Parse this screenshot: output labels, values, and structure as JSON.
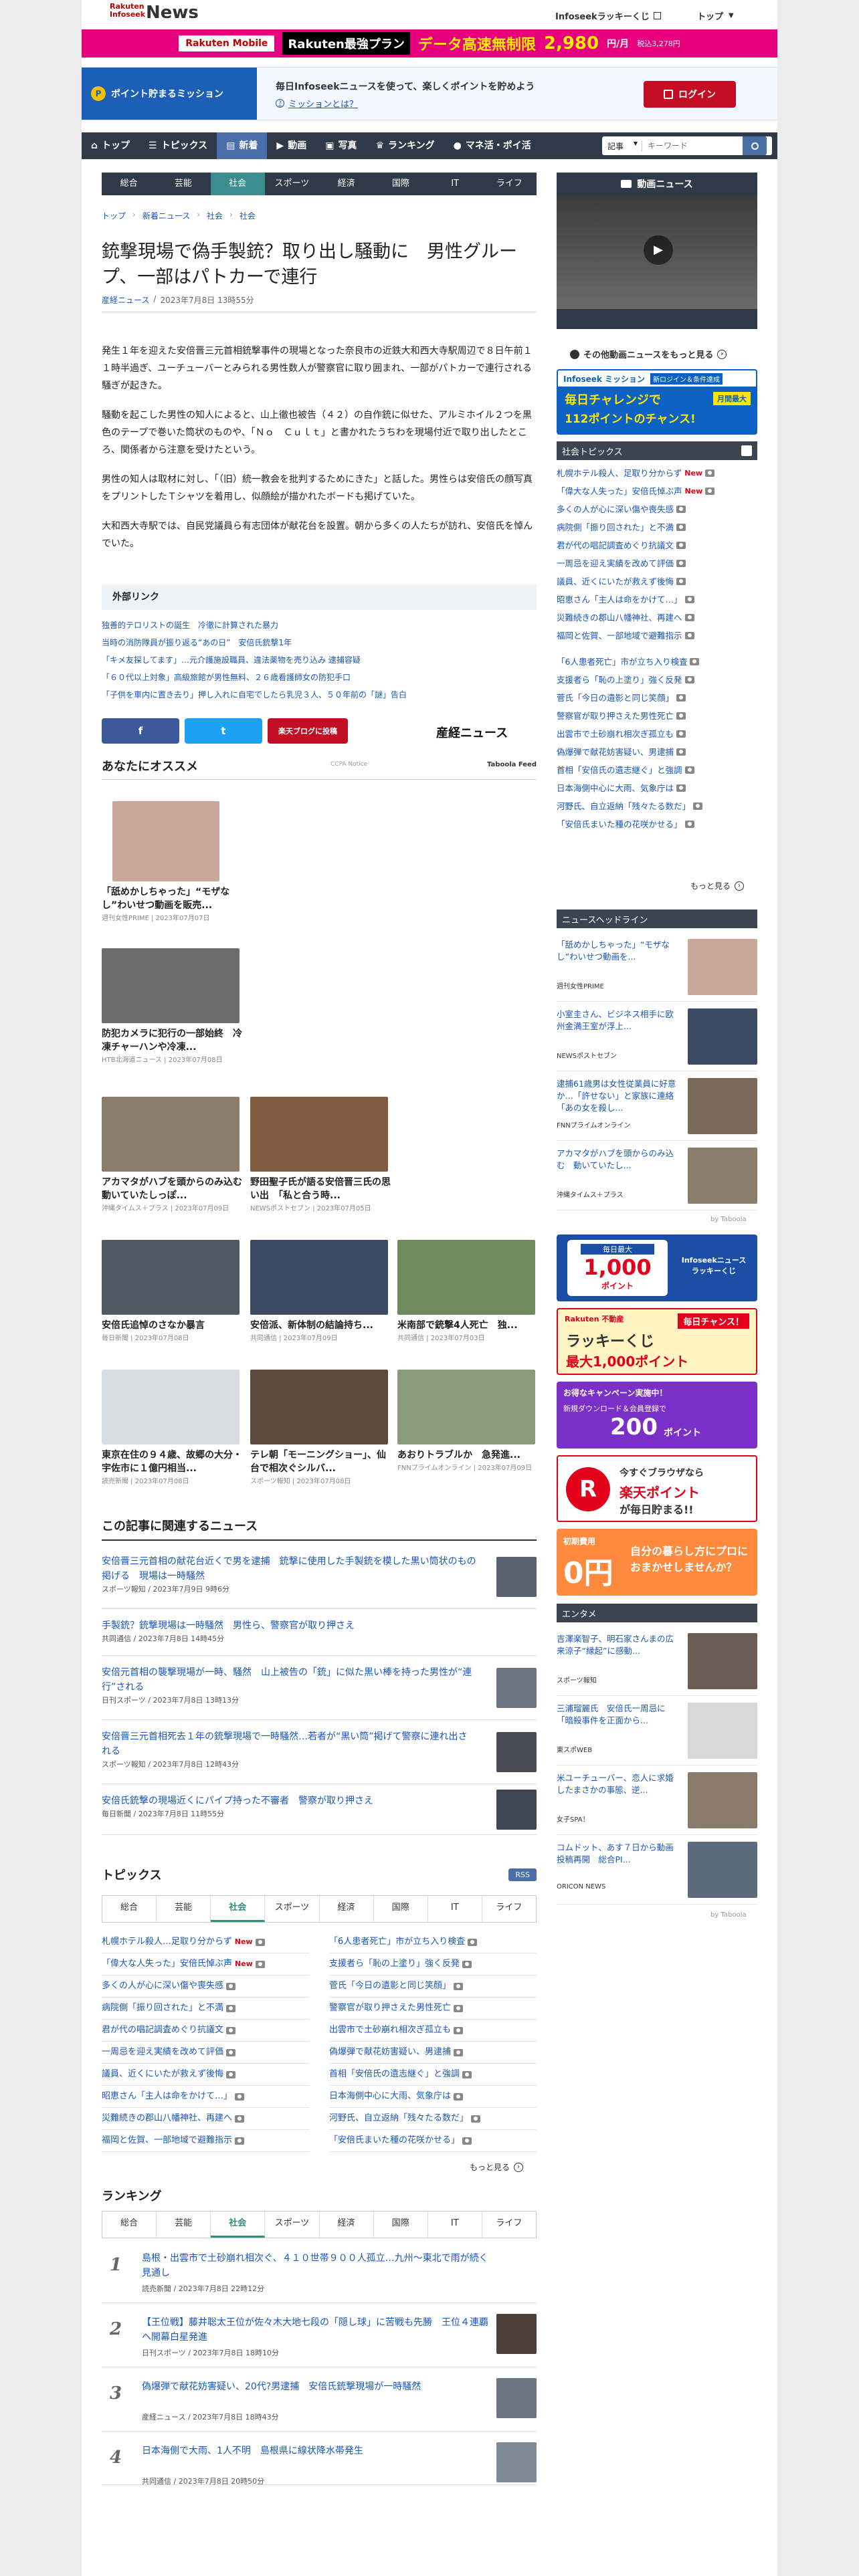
{
  "header": {
    "logo_small": "Rakuten\nInfoseek",
    "logo_big": "News",
    "util_1": "Infoseekラッキーくじ",
    "util_2": "トップ",
    "banner_text_1": "Rakuten Mobile",
    "banner_text_2": "Rakuten最強プラン",
    "banner_text_3": "データ高速無制限",
    "banner_price": "2,980",
    "banner_unit": "円/月",
    "banner_note": "税込3,278円"
  },
  "mission_bar": {
    "pill": "ポイント貯まるミッション",
    "text": "毎日Infoseekニュースを使って、楽しくポイントを貯めよう",
    "link": "ミッションとは？",
    "login": "ログイン"
  },
  "nav": {
    "items": [
      {
        "label": "トップ"
      },
      {
        "label": "トピックス"
      },
      {
        "label": "新着"
      },
      {
        "label": "動画"
      },
      {
        "label": "写真"
      },
      {
        "label": "ランキング"
      },
      {
        "label": "マネ活・ポイ活"
      }
    ],
    "search_select": "記事",
    "search_placeholder": "キーワード"
  },
  "subnav": [
    "総合",
    "芸能",
    "社会",
    "スポーツ",
    "経済",
    "国際",
    "IT",
    "ライフ"
  ],
  "breadcrumb": [
    "トップ",
    "新着ニュース",
    "社会",
    "社会"
  ],
  "article": {
    "title": "銃撃現場で偽手製銃？取り出し騒動に　男性グループ、一部はパトカーで連行",
    "source": "産経ニュース",
    "date": "2023年7月8日 13時55分",
    "paragraphs": [
      "発生１年を迎えた安倍晋三元首相銃撃事件の現場となった奈良市の近鉄大和西大寺駅周辺で８日午前１１時半過ぎ、ユーチューバーとみられる男性数人が警察官に取り囲まれ、一部がパトカーで連行される騒ぎが起きた。",
      "騒動を起こした男性の知人によると、山上徹也被告（４２）の自作銃に似せた、アルミホイル２つを黒色のテープで巻いた筒状のものや、「Ｎｏ　Ｃｕｌｔ」と書かれたうちわを現場付近で取り出したところ、関係者から注意を受けたという。",
      "男性の知人は取材に対し、「（旧）統一教会を批判するためにきた」と話した。男性らは安倍氏の顔写真をプリントしたＴシャツを着用し、似顔絵が描かれたボードも掲げていた。",
      "大和西大寺駅では、自民党議員ら有志団体が献花台を設置。朝から多くの人たちが訪れ、安倍氏を悼んでいた。"
    ]
  },
  "external_links": {
    "heading": "外部リンク",
    "items": [
      "独善的テロリストの誕生　冷徹に計算された暴力",
      "当時の消防隊員が振り返る“あの日”　安倍氏銃撃1年",
      "「キメ友探してます」…元介護施設職員、違法薬物を売り込み 逮捕容疑",
      "「６０代以上対象」高級旅館が男性無料、２６歳看護師女の防犯手口",
      "「子供を車内に置き去り」押し入れに自宅でしたら乳児３人、５０年前の「謎」告白"
    ]
  },
  "share": {
    "facebook": "f",
    "twitter": "t",
    "blog": "楽天ブログに投稿",
    "brand": "産経ニュース"
  },
  "recommend": {
    "heading": "あなたにオススメ",
    "powered": "CCPA Notice",
    "taboola": "Taboola Feed",
    "cards": [
      {
        "title": "「舐めかしちゃった」“モザなし”わいせつ動画を販売...",
        "meta": "週刊女性PRIME | 2023年07月07日",
        "color": "#c9a89a"
      },
      {
        "title": "防犯カメラに犯行の一部始終　冷凍チャーハンや冷凍...",
        "meta": "HTB北海道ニュース | 2023年07月08日",
        "color": "#6c6c6c"
      },
      {
        "title": "アカマタがハブを頭からのみ込む　動いていたしっぽ...",
        "meta": "沖縄タイムス＋プラス | 2023年07月09日",
        "color": "#8a7d6a"
      },
      {
        "title": "野田聖子氏が語る安倍晋三氏の思い出　「私と合う時...",
        "meta": "NEWSポストセブン | 2023年07月05日",
        "color": "#7f5b3f"
      },
      {
        "title": "安倍氏追悼のさなか暴言",
        "meta": "毎日新聞 | 2023年07月08日",
        "color": "#4f5a64"
      },
      {
        "title": "安倍派、新体制の結論持ち...",
        "meta": "共同通信 | 2023年07月09日",
        "color": "#3c4a66"
      },
      {
        "title": "米南部で銃撃4人死亡　独...",
        "meta": "共同通信 | 2023年07月03日",
        "color": "#6f8a5c"
      },
      {
        "title": "東京在住の９４歳、故郷の大分・宇佐市に１億円相当...",
        "meta": "読売新聞 | 2023年07月08日",
        "color": "#d9dde3"
      },
      {
        "title": "テレ朝「モーニングショー」、仙台で相次ぐシルバ...",
        "meta": "スポーツ報知 | 2023年07月08日",
        "color": "#5d4a3c"
      },
      {
        "title": "あおりトラブルか　急発進...",
        "meta": "FNNプライムオンライン | 2023年07月09日",
        "color": "#8a9a7a"
      }
    ]
  },
  "related": {
    "heading": "この記事に関連するニュース",
    "items": [
      {
        "title": "安倍晋三元首相の献花台近くで男を逮捕　銃撃に使用した手製銃を模した黒い筒状のもの掲げる　現場は一時騒然",
        "meta": "スポーツ報知 / 2023年7月9日 9時6分"
      },
      {
        "title": "手製銃？銃撃現場は一時騒然　男性ら、警察官が取り押さえ",
        "meta": "共同通信 / 2023年7月8日 14時45分"
      },
      {
        "title": "安倍元首相の襲撃現場が一時、騒然　山上被告の「銃」に似た黒い棒を持った男性が“連行”される",
        "meta": "日刊スポーツ / 2023年7月8日 13時13分"
      },
      {
        "title": "安倍晋三元首相死去１年の銃撃現場で一時騒然…若者が“黒い筒”掲げて警察に連れ出される",
        "meta": "スポーツ報知 / 2023年7月8日 12時43分"
      },
      {
        "title": "安倍氏銃撃の現場近くにパイプ持った不審者　警察が取り押さえ",
        "meta": "毎日新聞 / 2023年7月8日 11時55分"
      }
    ]
  },
  "topics": {
    "heading": "トピックス",
    "rss": "RSS",
    "tabs": [
      "総合",
      "芸能",
      "社会",
      "スポーツ",
      "経済",
      "国際",
      "IT",
      "ライフ"
    ],
    "left": [
      {
        "t": "札幌ホテル殺人…足取り分からず",
        "new": "New"
      },
      {
        "t": "「偉大な人失った」安倍氏悼ぶ声",
        "new": "New"
      },
      {
        "t": "多くの人が心に深い傷や喪失感",
        "new": ""
      },
      {
        "t": "病院側「振り回された」と不満",
        "new": ""
      },
      {
        "t": "君が代の唱記調査めぐり抗議文",
        "new": ""
      },
      {
        "t": "一周忌を迎え実績を改めて評価",
        "new": ""
      },
      {
        "t": "議員、近くにいたが救えず後悔",
        "new": ""
      },
      {
        "t": "昭恵さん「主人は命をかけて…」",
        "new": ""
      },
      {
        "t": "災難続きの郡山八幡神社、再建へ",
        "new": ""
      },
      {
        "t": "福岡と佐賀、一部地域で避難指示",
        "new": ""
      }
    ],
    "right": [
      "「6人患者死亡」市が立ち入り検査",
      "支援者ら「恥の上塗り」強く反発",
      "菅氏「今日の遺影と同じ笑顔」",
      "警察官が取り押さえた男性死亡",
      "出雲市で土砂崩れ相次ぎ孤立も",
      "偽爆弾で献花妨害疑い、男逮捕",
      "首相「安倍氏の遺志継ぐ」と強調",
      "日本海側中心に大雨、気象庁は",
      "河野氏、自立返納「残々たる数だ」",
      "「安倍氏まいた種の花咲かせる」"
    ],
    "more": "もっと見る"
  },
  "ranking": {
    "heading": "ランキング",
    "tabs": [
      "総合",
      "芸能",
      "社会",
      "スポーツ",
      "経済",
      "国際",
      "IT",
      "ライフ"
    ],
    "items": [
      {
        "num": "1",
        "title": "島根・出雲市で土砂崩れ相次ぐ、４１０世帯９００人孤立…九州～東北で雨が続く見通し",
        "meta": "読売新聞 / 2023年7月8日 22時12分",
        "thumb": ""
      },
      {
        "num": "2",
        "title": "【王位戦】藤井聡太王位が佐々木大地七段の「隠し球」に苦戦も先勝　王位４連覇へ開幕白星発進",
        "meta": "日刊スポーツ / 2023年7月8日 18時10分",
        "thumb": "#4a4038"
      },
      {
        "num": "3",
        "title": "偽爆弾で献花妨害疑い、20代?男逮捕　安倍氏銃撃現場が一時騒然",
        "meta": "産経ニュース / 2023年7月8日 18時43分",
        "thumb": "#6b7480"
      },
      {
        "num": "4",
        "title": "日本海側で大雨、1人不明　島根県に線状降水帯発生",
        "meta": "共同通信 / 2023年7月8日 20時50分",
        "thumb": "#7d8a96"
      }
    ]
  },
  "sidebar": {
    "video_heading": "動画ニュース",
    "video_more": "その他動画ニュースをもっと見る",
    "mission_banner": {
      "brand": "Infoseek ミッション",
      "tag": "新ロジイン＆条件達成",
      "line1": "毎日チャレンジで",
      "line2": "月間最大",
      "line3": "112ポイントのチャンス!"
    },
    "topics_heading": "社会トピックス",
    "topics": [
      {
        "t": "札幌ホテル殺人、足取り分からず",
        "new": "New"
      },
      {
        "t": "「偉大な人失った」安倍氏悼ぶ声",
        "new": "New"
      },
      {
        "t": "多くの人が心に深い傷や喪失感",
        "new": ""
      },
      {
        "t": "病院側「振り回された」と不満",
        "new": ""
      },
      {
        "t": "君が代の唱記調査めぐり抗議文",
        "new": ""
      },
      {
        "t": "一周忌を迎え実績を改めて評価",
        "new": ""
      },
      {
        "t": "議員、近くにいたが救えず後悔",
        "new": ""
      },
      {
        "t": "昭恵さん「主人は命をかけて…」",
        "new": ""
      },
      {
        "t": "災難続きの郡山八幡神社、再建へ",
        "new": ""
      },
      {
        "t": "福岡と佐賀、一部地域で避難指示",
        "new": ""
      },
      {
        "t": "「6人患者死亡」市が立ち入り検査",
        "new": ""
      },
      {
        "t": "支援者ら「恥の上塗り」強く反発",
        "new": ""
      },
      {
        "t": "菅氏「今日の遺影と同じ笑顔」",
        "new": ""
      },
      {
        "t": "警察官が取り押さえた男性死亡",
        "new": ""
      },
      {
        "t": "出雲市で土砂崩れ相次ぎ孤立も",
        "new": ""
      },
      {
        "t": "偽爆弾で献花妨害疑い、男逮捕",
        "new": ""
      },
      {
        "t": "首相「安倍氏の遺志継ぐ」と強調",
        "new": ""
      },
      {
        "t": "日本海側中心に大雨、気象庁は",
        "new": ""
      },
      {
        "t": "河野氏、自立返納「残々たる数だ」",
        "new": ""
      },
      {
        "t": "「安倍氏まいた種の花咲かせる」",
        "new": ""
      }
    ],
    "topics_more": "もっと見る",
    "headline_heading": "ニュースヘッドライン",
    "headlines": [
      {
        "title": "「舐めかしちゃった」“モザなし”わいせつ動画を...",
        "meta": "週刊女性PRIME",
        "color": "#c9a89a"
      },
      {
        "title": "小室圭さん、ビジネス相手に欧州金満王室が浮上...",
        "meta": "NEWSポストセブン",
        "color": "#3c4a66"
      },
      {
        "title": "逮捕61歳男は女性従業員に好意か…「許せない」と家族に連絡「あの女を殺し...",
        "meta": "FNNプライムオンライン",
        "color": "#7a6a5a"
      },
      {
        "title": "アカマタがハブを頭からのみ込む　動いていたし...",
        "meta": "沖縄タイムス＋プラス",
        "color": "#8a7d6a"
      }
    ],
    "taboola": "by Taboola",
    "ad1": {
      "line1": "毎日最大",
      "line2": "1,000",
      "line3": "ポイント",
      "brand": "Infoseekニュース ラッキーくじ"
    },
    "ad2": {
      "line1": "Rakuten 不動産",
      "line2": "ラッキーくじ",
      "line3": "最大1,000ポイント",
      "tag": "毎日チャンス！"
    },
    "ad3": {
      "line1": "お得なキャンペーン実施中！",
      "line2": "新規ダウンロード＆会員登録で",
      "line3": "200",
      "line4": "ポイント"
    },
    "ad4": {
      "line1": "今すぐブラウザなら",
      "line2": "楽天ポイント",
      "line3": "が毎日貯まる!!"
    },
    "ad5": {
      "line1": "初期費用",
      "line2": "0円",
      "line3": "自分の暮らし方にプロにおまかせしませんか？"
    },
    "entame_heading": "エンタメ",
    "entame": [
      {
        "title": "吉澤楽智子、明石家さんまの広来涼子“縁起”に感動...",
        "meta": "スポーツ報知",
        "color": "#6b5d55"
      },
      {
        "title": "三浦瑠麗氏　安倍氏一周忌に「暗殺事件を正面から...",
        "meta": "東スポWEB",
        "color": "#d8d8d8"
      },
      {
        "title": "米ユーチューバー、恋人に求婚したまさかの事態、逆...",
        "meta": "女子SPA！",
        "color": "#8a7a6c"
      },
      {
        "title": "コムドット、あす７日から動画投稿再開　総合PI...",
        "meta": "ORICON NEWS",
        "color": "#5a6a7a"
      }
    ]
  }
}
